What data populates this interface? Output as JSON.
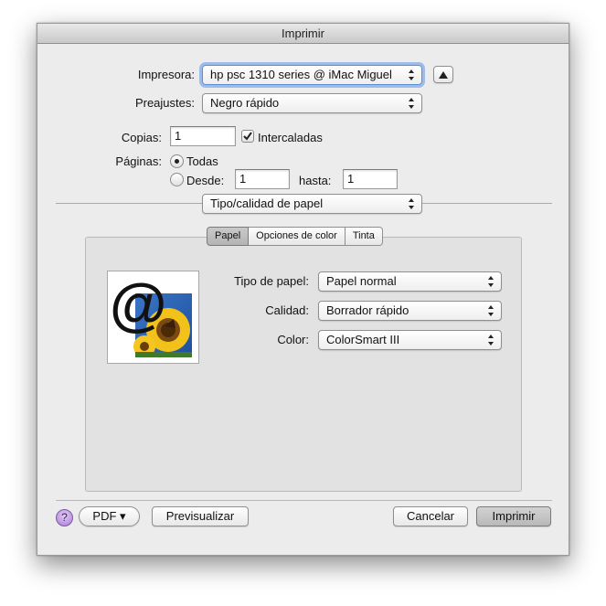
{
  "window": {
    "title": "Imprimir"
  },
  "printer": {
    "label": "Impresora:",
    "value": "hp psc 1310 series @ iMac Miguel",
    "toggle_icon": "triangle-up-icon"
  },
  "presets": {
    "label": "Preajustes:",
    "value": "Negro rápido"
  },
  "copies": {
    "label": "Copias:",
    "value": "1",
    "collated_label": "Intercaladas",
    "collated_checked": true
  },
  "pages": {
    "label": "Páginas:",
    "all_label": "Todas",
    "from_label": "Desde:",
    "from_value": "1",
    "to_label": "hasta:",
    "to_value": "1",
    "selected": "all"
  },
  "section": {
    "value": "Tipo/calidad de papel"
  },
  "tabs": [
    {
      "label": "Papel",
      "active": true
    },
    {
      "label": "Opciones de color",
      "active": false
    },
    {
      "label": "Tinta",
      "active": false
    }
  ],
  "paper": {
    "preview_glyph": "@",
    "type_label": "Tipo de papel:",
    "type_value": "Papel normal",
    "quality_label": "Calidad:",
    "quality_value": "Borrador rápido",
    "color_label": "Color:",
    "color_value": "ColorSmart III"
  },
  "footer": {
    "help": "?",
    "pdf": "PDF ▾",
    "preview": "Previsualizar",
    "cancel": "Cancelar",
    "print": "Imprimir"
  }
}
